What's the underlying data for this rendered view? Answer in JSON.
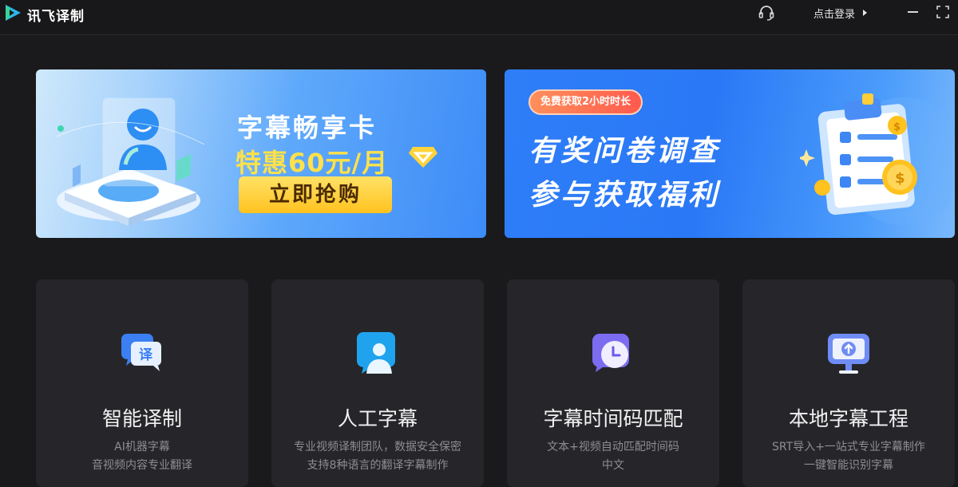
{
  "app": {
    "name": "讯飞译制"
  },
  "titlebar": {
    "login_label": "点击登录",
    "icons": [
      "headset-icon",
      "minimize-icon",
      "fullscreen-icon"
    ]
  },
  "banners": {
    "left": {
      "title": "字幕畅享卡",
      "price": "特惠60元/月",
      "button": "立即抢购"
    },
    "right": {
      "pill": "免费获取2小时时长",
      "line1": "有奖问卷调查",
      "line2": "参与获取福利"
    }
  },
  "cards": [
    {
      "title": "智能译制",
      "desc1": "AI机器字幕",
      "desc2": "音视频内容专业翻译",
      "icon": "translate-icon"
    },
    {
      "title": "人工字幕",
      "desc1": "专业视频译制团队，数据安全保密",
      "desc2": "支持8种语言的翻译字幕制作",
      "icon": "person-icon"
    },
    {
      "title": "字幕时间码匹配",
      "desc1": "文本+视频自动匹配时间码",
      "desc2": "中文",
      "icon": "clock-icon"
    },
    {
      "title": "本地字幕工程",
      "desc1": "SRT导入+一站式专业字幕制作",
      "desc2": "一键智能识别字幕",
      "icon": "upload-icon"
    }
  ],
  "colors": {
    "background": "#1a1a1c",
    "card": "#26262a",
    "accent_yellow": "#ffe14a",
    "button_yellow": "#ffc21f",
    "banner_blue": "#2f7ef8"
  }
}
